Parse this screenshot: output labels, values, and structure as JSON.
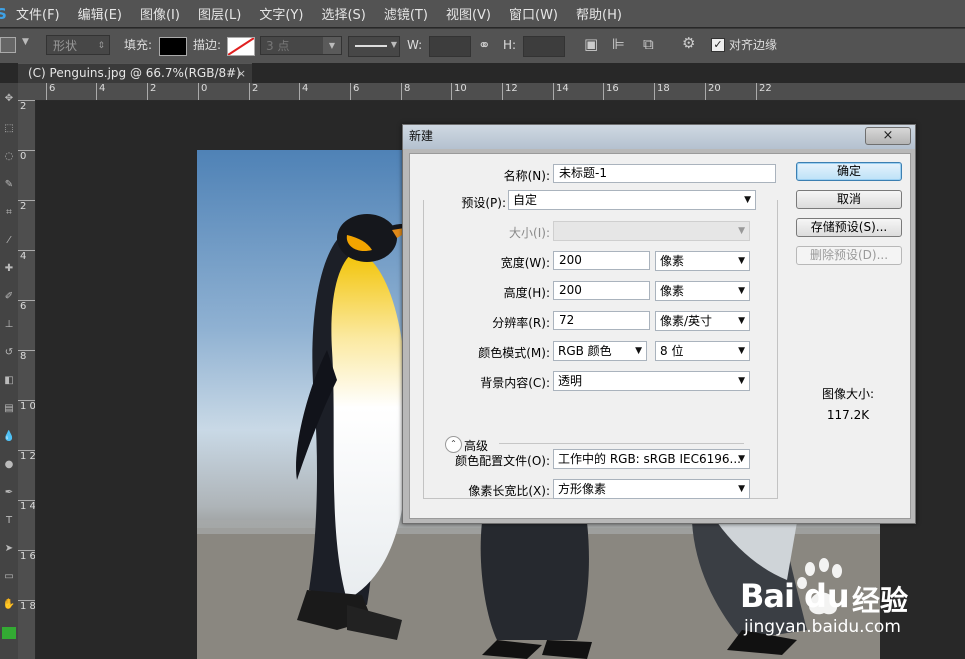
{
  "app": {
    "logo": "S"
  },
  "menu": [
    "文件(F)",
    "编辑(E)",
    "图像(I)",
    "图层(L)",
    "文字(Y)",
    "选择(S)",
    "滤镜(T)",
    "视图(V)",
    "窗口(W)",
    "帮助(H)"
  ],
  "options": {
    "mode": "形状",
    "fill_label": "填充:",
    "stroke_label": "描边:",
    "stroke_size": "3 点",
    "w_label": "W:",
    "h_label": "H:",
    "align_edges_label": "对齐边缘",
    "align_edges_checked": true
  },
  "tab": {
    "title": "(C) Penguins.jpg @ 66.7%(RGB/8#)",
    "close": "×"
  },
  "ruler_h": [
    "6",
    "4",
    "2",
    "0",
    "2",
    "4",
    "6",
    "8",
    "10",
    "12",
    "14",
    "16",
    "18",
    "20",
    "22"
  ],
  "ruler_v": [
    "2",
    "0",
    "2",
    "4",
    "6",
    "8",
    "1 0",
    "1 2",
    "1 4",
    "1 6",
    "1 8"
  ],
  "dialog": {
    "title": "新建",
    "close": "×",
    "name_label": "名称(N):",
    "name_value": "未标题-1",
    "preset_label": "预设(P):",
    "preset_value": "自定",
    "size_label": "大小(I):",
    "width_label": "宽度(W):",
    "width_value": "200",
    "width_unit": "像素",
    "height_label": "高度(H):",
    "height_value": "200",
    "height_unit": "像素",
    "resolution_label": "分辨率(R):",
    "resolution_value": "72",
    "resolution_unit": "像素/英寸",
    "color_mode_label": "颜色模式(M):",
    "color_mode_value": "RGB 颜色",
    "bit_depth": "8 位",
    "background_label": "背景内容(C):",
    "background_value": "透明",
    "advanced_label": "高级",
    "profile_label": "颜色配置文件(O):",
    "profile_value": "工作中的 RGB: sRGB IEC6196...",
    "aspect_label": "像素长宽比(X):",
    "aspect_value": "方形像素",
    "buttons": {
      "ok": "确定",
      "cancel": "取消",
      "save_preset": "存储预设(S)...",
      "delete_preset": "删除预设(D)..."
    },
    "image_size_label": "图像大小:",
    "image_size_value": "117.2K"
  },
  "watermark": {
    "brand_a": "Bai",
    "brand_b": "du",
    "brand_cn": "经验",
    "url": "jingyan.baidu.com"
  },
  "colors": {
    "accent": "#3c7fb1",
    "ps_blue": "#3fa2e6",
    "panel": "#535353",
    "workspace": "#282828"
  }
}
